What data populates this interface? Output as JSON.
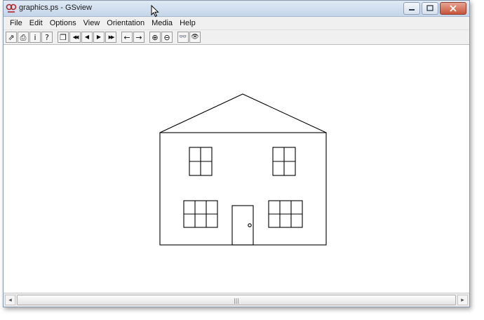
{
  "window": {
    "title": "graphics.ps - GSview",
    "app_icon": "gsview-logo-icon",
    "controls": {
      "minimize": "minimize-icon",
      "maximize": "maximize-icon",
      "close": "close-icon"
    }
  },
  "menu": [
    "File",
    "Edit",
    "Options",
    "View",
    "Orientation",
    "Media",
    "Help"
  ],
  "toolbar": {
    "buttons": [
      {
        "name": "open-button",
        "icon": "open-folder-icon",
        "glyph": "⇗"
      },
      {
        "name": "print-button",
        "icon": "printer-icon",
        "glyph": "⎙"
      },
      {
        "name": "info-button",
        "icon": "info-icon",
        "glyph": "i"
      },
      {
        "name": "help-button",
        "icon": "question-icon",
        "glyph": "?"
      },
      {
        "name": "goto-page-button",
        "icon": "page-icon",
        "glyph": "❐"
      },
      {
        "name": "first-page-button",
        "icon": "double-left-icon",
        "glyph": "◀◀"
      },
      {
        "name": "previous-page-button",
        "icon": "left-triangle-icon",
        "glyph": "◀"
      },
      {
        "name": "next-page-button",
        "icon": "right-triangle-icon",
        "glyph": "▶"
      },
      {
        "name": "last-page-button",
        "icon": "double-right-icon",
        "glyph": "▶▶"
      },
      {
        "name": "back-button",
        "icon": "left-arrow-icon",
        "glyph": "←"
      },
      {
        "name": "forward-button",
        "icon": "right-arrow-icon",
        "glyph": "→"
      },
      {
        "name": "zoom-in-button",
        "icon": "zoom-in-icon",
        "glyph": "⊕"
      },
      {
        "name": "zoom-out-button",
        "icon": "zoom-out-icon",
        "glyph": "⊖"
      },
      {
        "name": "view-button",
        "icon": "eyes-icon",
        "glyph": "👓"
      },
      {
        "name": "view-alt-button",
        "icon": "eyes-alt-icon",
        "glyph": "👁"
      }
    ]
  },
  "document": {
    "content": "house-drawing"
  },
  "scrollbar": {
    "left_icon": "scroll-left-icon",
    "right_icon": "scroll-right-icon",
    "grip": "|||"
  },
  "colors": {
    "titlebar_top": "#dfe9f5",
    "titlebar_bottom": "#c5d6ea",
    "close_button": "#c7543c",
    "drawing_stroke": "#000000"
  }
}
